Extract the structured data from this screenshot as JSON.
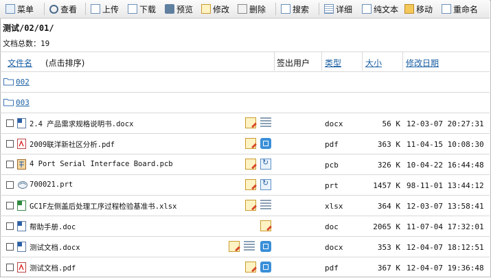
{
  "toolbar": {
    "items": [
      "菜单",
      "查看",
      "上传",
      "下载",
      "预览",
      "修改",
      "删除",
      "搜索",
      "详细",
      "纯文本",
      "移动",
      "重命名"
    ]
  },
  "path": "测试/02/01/",
  "doc_count": "文档总数：19",
  "headers": {
    "name": "文件名",
    "sort_hint": "(点击排序)",
    "checkout_user": "签出用户",
    "type": "类型",
    "size": "大小",
    "modified": "修改日期"
  },
  "folders": [
    "002",
    "003"
  ],
  "files": [
    {
      "name": "2.4 产品需求规格说明书.docx",
      "type": "docx",
      "size": "56 K",
      "date": "12-03-07 20:27:31",
      "icon": "word-doc-icon"
    },
    {
      "name": "2009联洋新社区分析.pdf",
      "type": "pdf",
      "size": "363 K",
      "date": "11-04-15 10:08:30",
      "icon": "pdf-icon"
    },
    {
      "name": "4 Port Serial Interface Board.pcb",
      "type": "pcb",
      "size": "326 K",
      "date": "10-04-22 16:44:48",
      "icon": "pcb-icon"
    },
    {
      "name": "700021.prt",
      "type": "prt",
      "size": "1457 K",
      "date": "98-11-01 13:44:12",
      "icon": "prt-icon"
    },
    {
      "name": "GC1F左侧盖后处理工序过程检验基准书.xlsx",
      "type": "xlsx",
      "size": "364 K",
      "date": "12-03-07 13:58:41",
      "icon": "excel-icon"
    },
    {
      "name": "帮助手册.doc",
      "type": "doc",
      "size": "2065 K",
      "date": "11-07-04 17:32:01",
      "icon": "word-doc-icon"
    },
    {
      "name": "测试文档.docx",
      "type": "docx",
      "size": "353 K",
      "date": "12-04-07 18:12:51",
      "icon": "word-doc-icon"
    },
    {
      "name": "测试文档.pdf",
      "type": "pdf",
      "size": "367 K",
      "date": "12-04-07 19:36:48",
      "icon": "pdf-icon"
    }
  ]
}
